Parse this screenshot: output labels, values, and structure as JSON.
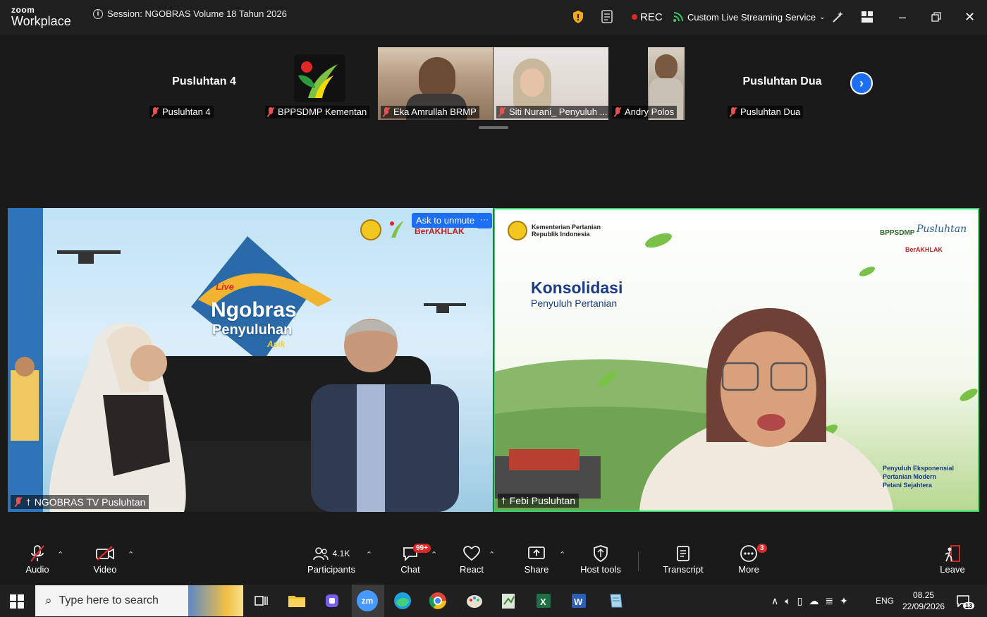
{
  "app": {
    "logo_top": "zoom",
    "logo_bottom": "Workplace"
  },
  "session": {
    "title": "Session: NGOBRAS Volume 18 Tahun 2026"
  },
  "titlebar": {
    "rec_label": "REC",
    "stream_label": "Custom Live Streaming Service"
  },
  "participants_strip": [
    {
      "display": "Pusluhtan 4",
      "name": "Pusluhtan 4"
    },
    {
      "display": "",
      "name": "BPPSDMP Kementan"
    },
    {
      "display": "",
      "name": "Eka Amrullah BRMP"
    },
    {
      "display": "",
      "name": "Siti Nurani_ Penyuluh ..."
    },
    {
      "display": "",
      "name": "Andry Polos"
    },
    {
      "display": "Pusluhtan Dua",
      "name": "Pusluhtan Dua"
    }
  ],
  "main_videos": {
    "left": {
      "name": "NGOBRAS TV Pusluhtan",
      "ask_unmute": "Ask to unmute",
      "more": "···",
      "banner_live": "Live",
      "banner_title": "Ngobras",
      "banner_sub": "Penyuluhan",
      "banner_asik": "Asik",
      "berakhlak": "BerAKHLAK"
    },
    "right": {
      "name": "Febi Pusluhtan",
      "ministry_line1": "Kementerian Pertanian",
      "ministry_line2": "Republik Indonesia",
      "bppsdmp": "BPPSDMP",
      "pusluhtan_logo": "Pusluhtan",
      "berakhlak": "BerAKHLAK",
      "heading": "Konsolidasi",
      "subheading": "Penyuluh Pertanian",
      "tagline": [
        "Penyuluh Eksponensial",
        "Pertanian Modern",
        "Petani Sejahtera"
      ]
    }
  },
  "controls": {
    "audio": "Audio",
    "video": "Video",
    "participants": "Participants",
    "participants_count": "4.1K",
    "chat": "Chat",
    "chat_badge": "99+",
    "react": "React",
    "share": "Share",
    "host_tools": "Host tools",
    "transcript": "Transcript",
    "more": "More",
    "more_badge": "3",
    "leave": "Leave"
  },
  "taskbar": {
    "search_placeholder": "Type here to search",
    "language": "ENG",
    "time": "08.25",
    "date": "22/09/2026",
    "notifications": "13",
    "zoom_app": "zm"
  },
  "colors": {
    "accent": "#1c6ff2",
    "record": "#e02828",
    "speaker_border": "#2bd66b"
  }
}
